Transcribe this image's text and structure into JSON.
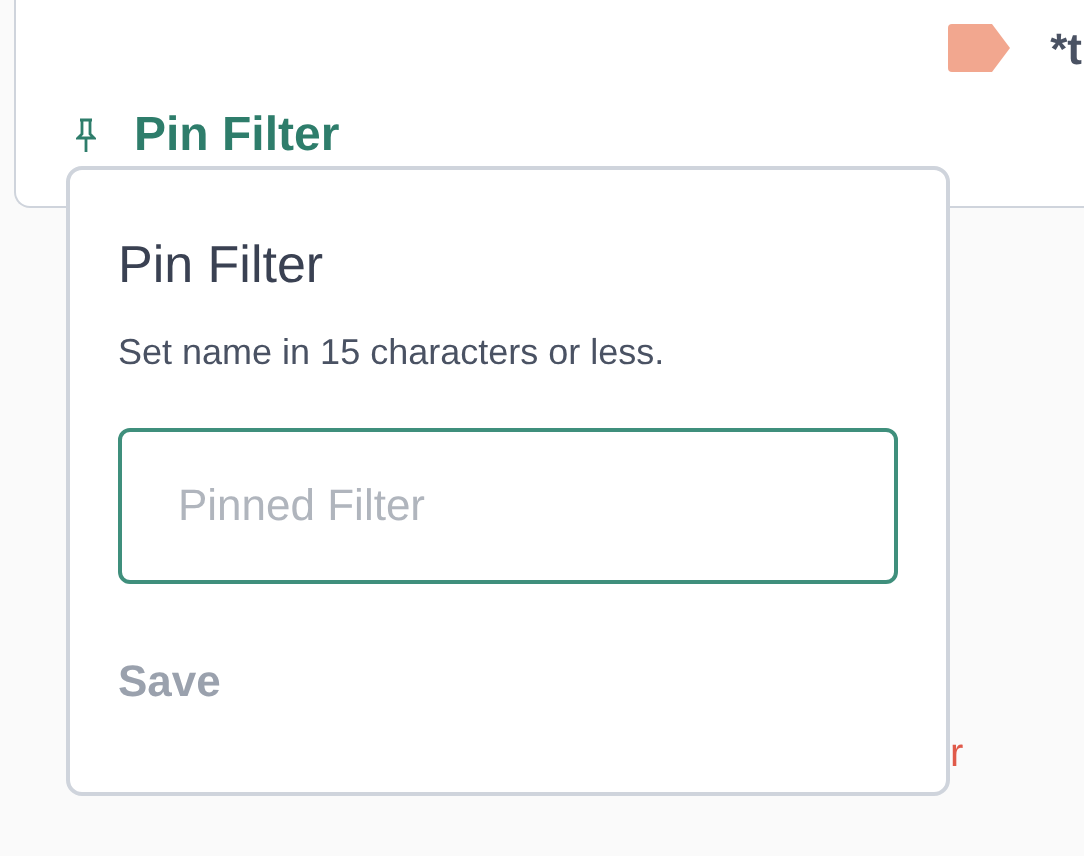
{
  "card": {
    "tag": {
      "color": "#f2a78f",
      "label": "*t"
    },
    "pin_link": "Pin Filter"
  },
  "behind_text": "r",
  "popover": {
    "title": "Pin Filter",
    "hint": "Set name in 15 characters or less.",
    "name_field": {
      "placeholder": "Pinned Filter"
    },
    "save_button": {
      "label": "Save",
      "disabled": true
    }
  }
}
